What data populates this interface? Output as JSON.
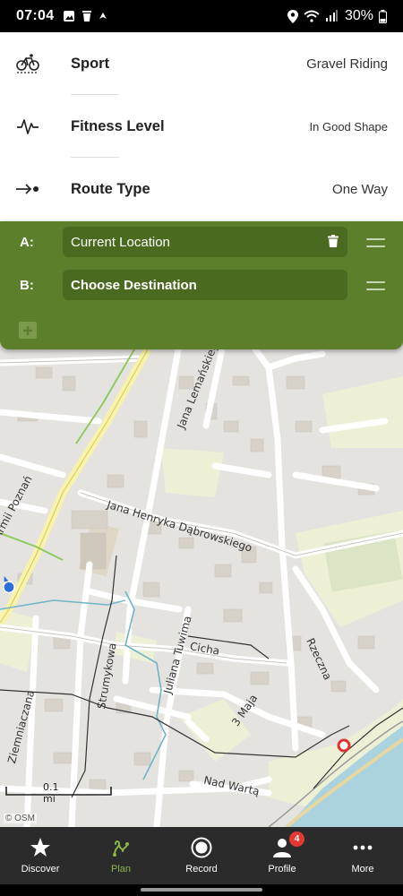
{
  "status_bar": {
    "time": "07:04",
    "battery": "30%"
  },
  "settings": [
    {
      "label": "Sport",
      "value": "Gravel Riding",
      "icon": "gravel-bike-icon"
    },
    {
      "label": "Fitness Level",
      "value": "In Good Shape",
      "icon": "fitness-pulse-icon"
    },
    {
      "label": "Route Type",
      "value": "One Way",
      "icon": "one-way-arrow-icon"
    }
  ],
  "route": {
    "a_label": "A:",
    "a_value": "Current Location",
    "b_label": "B:",
    "b_value": "Choose Destination"
  },
  "map": {
    "streets": {
      "armii": "Armii Poznań",
      "lemanskiego": "Jana Lemańskiego",
      "dabrowskiego": "Jana Henryka Dąbrowskiego",
      "tuwima": "Juliana Tuwima",
      "cicha": "Cicha",
      "strumykowa": "Strumykowa",
      "rzeczna": "Rzeczna",
      "maja": "3 Maja",
      "ziemniaczana": "Ziemniaczana",
      "nadwarta": "Nad Wartą"
    },
    "scale": "0.1 mi",
    "attribution": "© OSM"
  },
  "nav": [
    {
      "label": "Discover",
      "icon": "star-icon"
    },
    {
      "label": "Plan",
      "icon": "route-plan-icon",
      "active": true
    },
    {
      "label": "Record",
      "icon": "record-icon"
    },
    {
      "label": "Profile",
      "icon": "profile-icon",
      "badge": "4"
    },
    {
      "label": "More",
      "icon": "more-dots-icon"
    }
  ],
  "colors": {
    "accent_green": "#5b7f2a",
    "active_nav": "#8bb54a",
    "badge_red": "#e03a33"
  }
}
